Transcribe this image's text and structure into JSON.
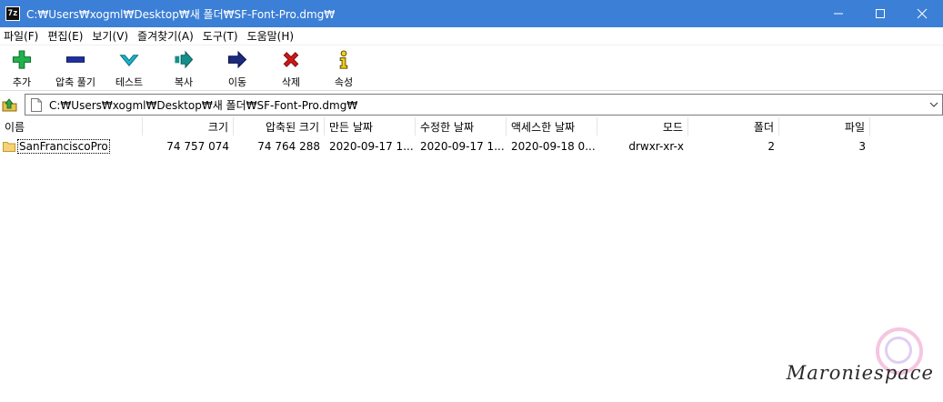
{
  "window": {
    "app_icon_text": "7z",
    "title": "C:₩Users₩xogml₩Desktop₩새 폴더₩SF-Font-Pro.dmg₩"
  },
  "menu": [
    {
      "label": "파일(F)"
    },
    {
      "label": "편집(E)"
    },
    {
      "label": "보기(V)"
    },
    {
      "label": "즐겨찾기(A)"
    },
    {
      "label": "도구(T)"
    },
    {
      "label": "도움말(H)"
    }
  ],
  "toolbar": [
    {
      "label": "추가",
      "icon": "plus-icon",
      "color": "#22b14c"
    },
    {
      "label": "압축 풀기",
      "icon": "minus-icon",
      "color": "#1f2f9e"
    },
    {
      "label": "테스트",
      "icon": "check-icon",
      "color": "#18b4c8"
    },
    {
      "label": "복사",
      "icon": "copy-arrow-icon",
      "color": "#14908a"
    },
    {
      "label": "이동",
      "icon": "move-arrow-icon",
      "color": "#1b2a7e"
    },
    {
      "label": "삭제",
      "icon": "x-icon",
      "color": "#d01818"
    },
    {
      "label": "속성",
      "icon": "info-icon",
      "color": "#c9a800"
    }
  ],
  "address": {
    "path": "C:₩Users₩xogml₩Desktop₩새 폴더₩SF-Font-Pro.dmg₩"
  },
  "columns": [
    {
      "label": "이름"
    },
    {
      "label": "크기"
    },
    {
      "label": "압축된 크기"
    },
    {
      "label": "만든 날짜"
    },
    {
      "label": "수정한 날짜"
    },
    {
      "label": "액세스한 날짜"
    },
    {
      "label": "모드"
    },
    {
      "label": "폴더"
    },
    {
      "label": "파일"
    }
  ],
  "rows": [
    {
      "name": "SanFranciscoPro",
      "size": "74 757 074",
      "packed_size": "74 764 288",
      "created": "2020-09-17 1...",
      "modified": "2020-09-17 1...",
      "accessed": "2020-09-18 0...",
      "mode": "drwxr-xr-x",
      "folders": "2",
      "files": "3"
    }
  ],
  "watermark": {
    "text": "Maroniespace"
  }
}
